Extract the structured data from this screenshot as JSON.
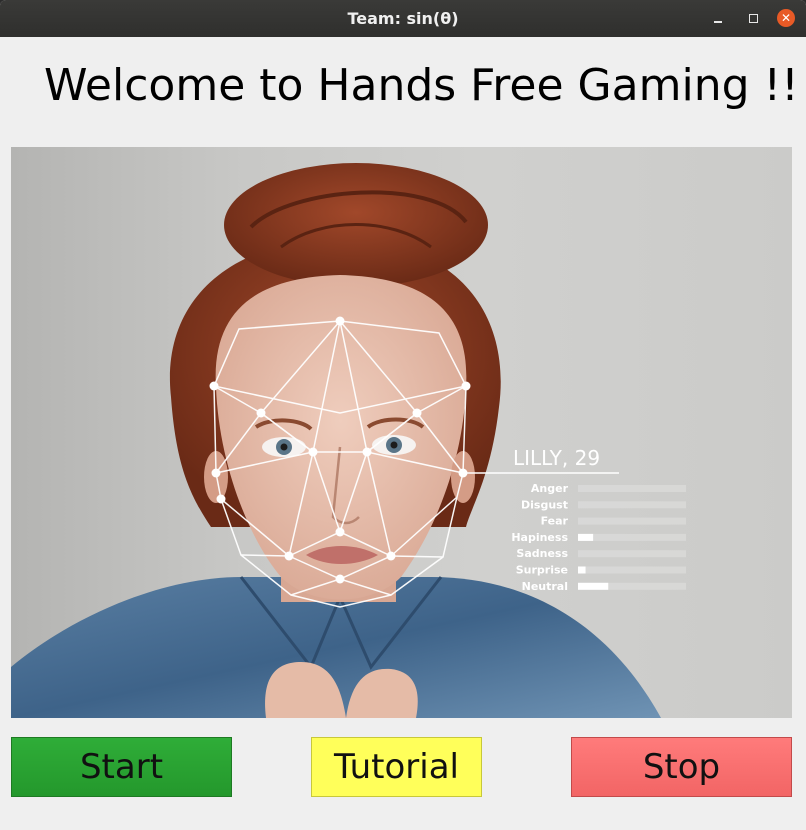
{
  "window": {
    "title": "Team: sin(θ)",
    "controls": {
      "minimize_icon": "minimize-icon",
      "maximize_icon": "maximize-icon",
      "close_icon": "close-icon",
      "close_glyph": "✕"
    }
  },
  "headline": "Welcome to Hands Free Gaming !!",
  "preview": {
    "subject": "LILLY, 29",
    "emotions": [
      {
        "label": "Anger",
        "level": 0
      },
      {
        "label": "Disgust",
        "level": 0
      },
      {
        "label": "Fear",
        "level": 0
      },
      {
        "label": "Hapiness",
        "level": 0.14
      },
      {
        "label": "Sadness",
        "level": 0
      },
      {
        "label": "Surprise",
        "level": 0.07
      },
      {
        "label": "Neutral",
        "level": 0.28
      }
    ]
  },
  "buttons": {
    "start": "Start",
    "tutorial": "Tutorial",
    "stop": "Stop"
  },
  "colors": {
    "start": "#28a632",
    "tutorial": "#ffff5a",
    "stop": "#f77070",
    "close": "#e85a26"
  }
}
